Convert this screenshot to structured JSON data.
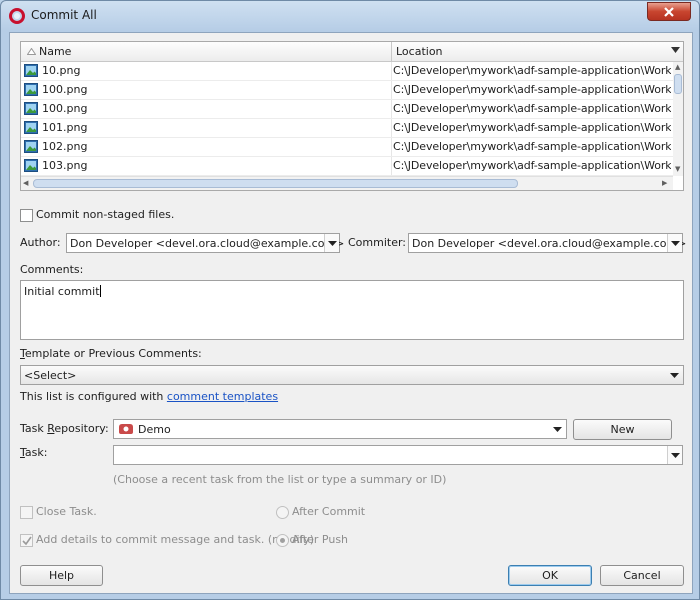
{
  "window": {
    "title": "Commit All",
    "accent": "#1a53c5",
    "close_color": "#c8452f"
  },
  "table": {
    "columns": [
      "Name",
      "Location"
    ],
    "rows": [
      {
        "name": "10.png",
        "location": "C:\\JDeveloper\\mywork\\adf-sample-application\\WorkBetter"
      },
      {
        "name": "100.png",
        "location": "C:\\JDeveloper\\mywork\\adf-sample-application\\WorkBetter"
      },
      {
        "name": "100.png",
        "location": "C:\\JDeveloper\\mywork\\adf-sample-application\\WorkBetter"
      },
      {
        "name": "101.png",
        "location": "C:\\JDeveloper\\mywork\\adf-sample-application\\WorkBetter"
      },
      {
        "name": "102.png",
        "location": "C:\\JDeveloper\\mywork\\adf-sample-application\\WorkBetter"
      },
      {
        "name": "103.png",
        "location": "C:\\JDeveloper\\mywork\\adf-sample-application\\WorkBetter"
      }
    ],
    "row_icon": "image-file-icon"
  },
  "form": {
    "commit_nonstaged_label": "Commit non-staged files.",
    "author_label": "Author:",
    "author_value": "Don Developer <devel.ora.cloud@example.com>",
    "commiter_label": "Commiter:",
    "commiter_value": "Don Developer <devel.ora.cloud@example.com>",
    "comments_label": "Comments:",
    "comments_value": "Initial commit",
    "template_label_pre": "T",
    "template_label_post": "emplate or Previous Comments:",
    "template_value": "<Select>",
    "configured_text": "This list is configured with ",
    "configured_link": "comment templates",
    "task_repo_label_pre": "Task ",
    "task_repo_label_u": "R",
    "task_repo_label_post": "epository:",
    "task_repo_value": "Demo",
    "new_button": "New",
    "task_label_u": "T",
    "task_label_post": "ask:",
    "task_value": "",
    "task_hint": "(Choose a recent task from the list or type a summary or ID)",
    "close_task_label": "Close Task.",
    "after_commit_label": "After Commit",
    "add_details_label": "Add details to commit message and task. (modify)",
    "after_push_label": "After Push"
  },
  "buttons": {
    "help": "Help",
    "ok": "OK",
    "cancel": "Cancel"
  }
}
